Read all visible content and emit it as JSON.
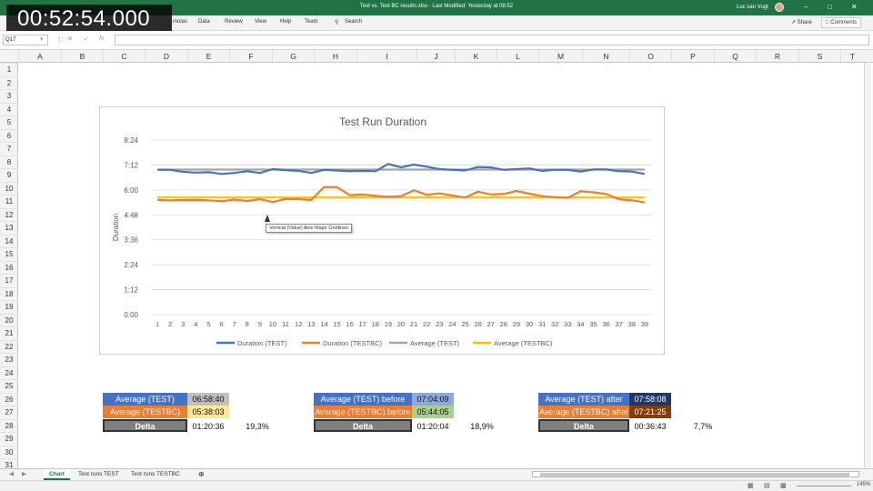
{
  "window": {
    "doc_title": "Test vs. Test BC results.xlsx  ·  Last Modified: Yesterday at 08:52",
    "user": "Luc van Vugt"
  },
  "ribbon": {
    "tabs": [
      "mulas",
      "Data",
      "Review",
      "View",
      "Help",
      "Team"
    ],
    "search": "Search",
    "share": "Share",
    "comments": "Comments"
  },
  "timer": "00:52:54.000",
  "formula_bar": {
    "name_box": "Q17",
    "formula": ""
  },
  "columns": [
    "A",
    "B",
    "C",
    "D",
    "E",
    "F",
    "G",
    "H",
    "I",
    "J",
    "K",
    "L",
    "M",
    "N",
    "O",
    "P",
    "Q",
    "R",
    "S",
    "T"
  ],
  "rows": [
    "1",
    "2",
    "3",
    "4",
    "5",
    "6",
    "7",
    "8",
    "9",
    "10",
    "11",
    "12",
    "13",
    "14",
    "15",
    "16",
    "17",
    "18",
    "19",
    "20",
    "21",
    "22",
    "23",
    "24",
    "25",
    "26",
    "27",
    "28",
    "29",
    "30",
    "31"
  ],
  "chart_data": {
    "type": "line",
    "title": "Test Run Duration",
    "ylabel": "Duration",
    "xlabel": "",
    "x": [
      1,
      2,
      3,
      4,
      5,
      6,
      7,
      8,
      9,
      10,
      11,
      12,
      13,
      14,
      15,
      16,
      17,
      18,
      19,
      20,
      21,
      22,
      23,
      24,
      25,
      26,
      27,
      28,
      29,
      30,
      31,
      32,
      33,
      34,
      35,
      36,
      37,
      38,
      39
    ],
    "y_ticks": [
      "0:00",
      "1:12",
      "2:24",
      "3:36",
      "4:48",
      "6:00",
      "7:12",
      "8:24"
    ],
    "ylim": [
      "0:00",
      "8:24"
    ],
    "grid": true,
    "legend_position": "bottom",
    "series": [
      {
        "name": "Duration (TEST)",
        "color": "#4472c4",
        "values_minutes": [
          418,
          418,
          412,
          410,
          411,
          406,
          409,
          414,
          409,
          420,
          417,
          415,
          409,
          418,
          416,
          414,
          415,
          414,
          435,
          425,
          433,
          427,
          420,
          418,
          416,
          426,
          425,
          418,
          420,
          422,
          415,
          418,
          418,
          413,
          419,
          419,
          414,
          413,
          406
        ]
      },
      {
        "name": "Duration (TESTBC)",
        "color": "#ed7d31",
        "values_minutes": [
          331,
          330,
          331,
          331,
          330,
          327,
          332,
          328,
          333,
          325,
          334,
          333,
          331,
          368,
          368,
          345,
          347,
          343,
          340,
          342,
          359,
          346,
          350,
          344,
          338,
          355,
          347,
          348,
          357,
          349,
          342,
          339,
          337,
          356,
          353,
          348,
          333,
          330,
          324
        ]
      },
      {
        "name": "Average (TEST)",
        "color": "#a5a5a5",
        "values_minutes": [
          418.7,
          418.7,
          418.7,
          418.7,
          418.7,
          418.7,
          418.7,
          418.7,
          418.7,
          418.7,
          418.7,
          418.7,
          418.7,
          418.7,
          418.7,
          418.7,
          418.7,
          418.7,
          418.7,
          418.7,
          418.7,
          418.7,
          418.7,
          418.7,
          418.7,
          418.7,
          418.7,
          418.7,
          418.7,
          418.7,
          418.7,
          418.7,
          418.7,
          418.7,
          418.7,
          418.7,
          418.7,
          418.7,
          418.7
        ]
      },
      {
        "name": "Average (TESTBC)",
        "color": "#ffc000",
        "values_minutes": [
          338,
          338,
          338,
          338,
          338,
          338,
          338,
          338,
          338,
          338,
          338,
          338,
          338,
          338,
          338,
          338,
          338,
          338,
          338,
          338,
          338,
          338,
          338,
          338,
          338,
          338,
          338,
          338,
          338,
          338,
          338,
          338,
          338,
          338,
          338,
          338,
          338,
          338,
          338
        ]
      }
    ]
  },
  "tooltip": "Vertical (Value) Axis Major Gridlines",
  "summary": {
    "block1": {
      "avg_test_label": "Average (TEST)",
      "avg_test_value": "06:58:40",
      "avg_testbc_label": "Average (TESTBC)",
      "avg_testbc_value": "05:38:03",
      "delta_label": "Delta",
      "delta_value": "01:20:36",
      "delta_pct": "19,3%",
      "avg_test_value_bg": "#bfbfbf",
      "avg_testbc_value_bg": "#ffe699"
    },
    "block2": {
      "avg_test_label": "Average (TEST) before",
      "avg_test_value": "07:04:09",
      "avg_testbc_label": "Average (TESTBC) before",
      "avg_testbc_value": "05:44:05",
      "delta_label": "Delta",
      "delta_value": "01:20:04",
      "delta_pct": "18,9%",
      "avg_test_value_bg": "#8ea9db",
      "avg_testbc_value_bg": "#a9d08e"
    },
    "block3": {
      "avg_test_label": "Average (TEST) after",
      "avg_test_value": "07:58:08",
      "avg_testbc_label": "Average (TESTBC) after",
      "avg_testbc_value": "07:21:25",
      "delta_label": "Delta",
      "delta_value": "00:36:43",
      "delta_pct": "7,7%",
      "avg_test_value_bg": "#1f3864",
      "avg_testbc_value_bg": "#843c0c"
    }
  },
  "sheets": [
    "Chart",
    "Test runs TEST",
    "Test runs TESTBC"
  ],
  "status": {
    "zoom": "145%"
  }
}
